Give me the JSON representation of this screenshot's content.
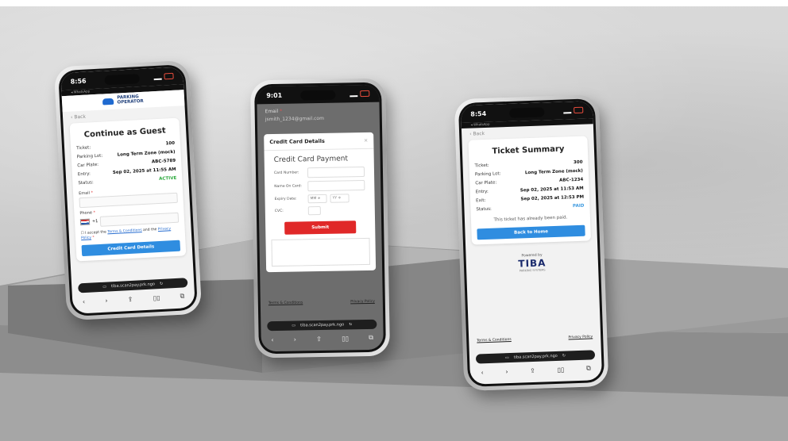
{
  "left_phone": {
    "time": "8:56",
    "sub_status": "◂ WhatsApp",
    "brand_line1": "PARKING",
    "brand_line2": "OPERATOR",
    "back": "‹ Back",
    "title": "Continue as Guest",
    "rows": [
      {
        "label": "Ticket:",
        "value": "100"
      },
      {
        "label": "Parking Lot:",
        "value": "Long Term Zone (mock)"
      },
      {
        "label": "Car Plate:",
        "value": "ABC-5789"
      },
      {
        "label": "Entry:",
        "value": "Sep 02, 2025 at 11:55 AM"
      },
      {
        "label": "Status:",
        "value": "ACTIVE"
      }
    ],
    "email_label": "Email",
    "phone_label": "Phone",
    "dial_code": "+1",
    "terms_prefix": "I accept the",
    "terms_link": "Terms & Conditions",
    "terms_and": "and the",
    "privacy_link": "Privacy Policy",
    "button": "Credit Card Details",
    "url": "tiba.scan2pay.prk.ngo"
  },
  "middle_phone": {
    "time": "9:01",
    "email_label": "Email",
    "email_value": "jsmith_1234@gmail.com",
    "modal_title": "Credit Card Details",
    "modal_close": "×",
    "form_title": "Credit Card Payment",
    "card_number_label": "Card Number:",
    "name_label": "Name On Card:",
    "expiry_label": "Expiry Date:",
    "mm_placeholder": "MM ≑",
    "yy_placeholder": "YY ≑",
    "cvc_label": "CVC:",
    "submit": "Submit",
    "terms": "Terms & Conditions",
    "privacy": "Privacy Policy",
    "url": "tiba.scan2pay.prk.ngo"
  },
  "right_phone": {
    "time": "8:54",
    "sub_status": "◂ WhatsApp",
    "back": "‹ Back",
    "title": "Ticket Summary",
    "rows": [
      {
        "label": "Ticket:",
        "value": "300"
      },
      {
        "label": "Parking Lot:",
        "value": "Long Term Zone (mock)"
      },
      {
        "label": "Car Plate:",
        "value": "ABC-1234"
      },
      {
        "label": "Entry:",
        "value": "Sep 02, 2025 at 11:53 AM"
      },
      {
        "label": "Exit:",
        "value": "Sep 02, 2025 at 12:53 PM"
      },
      {
        "label": "Status:",
        "value": "PAID"
      }
    ],
    "paid_message": "This ticket has already been paid.",
    "button": "Back to Home",
    "powered_by": "Powered by",
    "logo": "TIBA",
    "logo_sub": "PARKING SYSTEMS",
    "terms": "Terms & Conditions",
    "privacy": "Privacy Policy",
    "url": "tiba.scan2pay.prk.ngo"
  },
  "colors": {
    "accent_blue": "#2f8de0",
    "submit_red": "#e02828",
    "active_green": "#2eaa3f",
    "paid_blue": "#3f9be0"
  }
}
